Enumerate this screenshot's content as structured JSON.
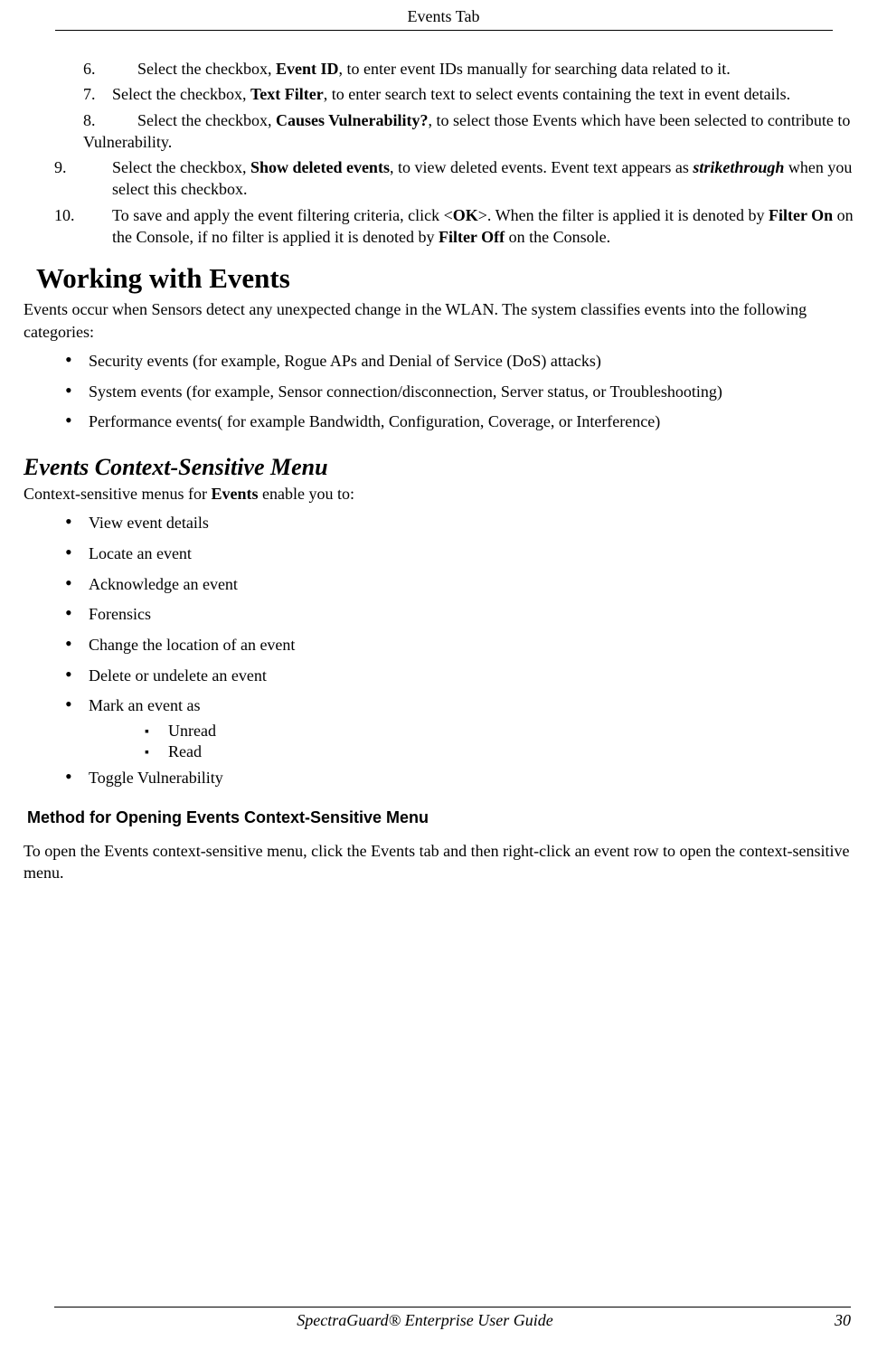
{
  "header": {
    "title": "Events Tab"
  },
  "ol": [
    {
      "num": "6.",
      "pre": "Select the checkbox, ",
      "bold": "Event ID",
      "post": ", to enter event IDs manually for searching data related to it.",
      "wide_num": true
    },
    {
      "num": "7.",
      "pre": "Select the checkbox, ",
      "bold": "Text Filter",
      "post": ", to enter search text to select events containing the text in event details.",
      "wide_num": false
    },
    {
      "num": "8.",
      "pre": "Select the checkbox, ",
      "bold": "Causes Vulnerability?",
      "post": ", to select those Events which have been selected to contribute to Vulnerability.",
      "wide_num": true
    },
    {
      "num": "9.",
      "pre": "Select the checkbox, ",
      "bold": "Show deleted events",
      "post_a": ", to view deleted events. Event text appears as ",
      "bold_italic": "strikethrough",
      "post_b": " when you select this checkbox.",
      "wide_num": false
    },
    {
      "num": "10.",
      "pre": "To save and apply the event filtering criteria, click <",
      "bold_a": "OK",
      "mid_a": ">. When the filter is applied it is denoted by ",
      "bold_b": "Filter On",
      "mid_b": " on the Console, if no filter is applied it is denoted by ",
      "bold_c": "Filter Off",
      "post": " on the Console.",
      "wide_num": false
    }
  ],
  "section1": {
    "title": "Working with Events",
    "intro": "Events occur when Sensors detect any unexpected change in the WLAN. The system classifies events into the following categories:",
    "bullets": [
      "Security events (for example, Rogue APs and Denial of Service (DoS) attacks)",
      "System events (for example, Sensor connection/disconnection, Server status, or Troubleshooting)",
      "Performance events( for example Bandwidth, Configuration, Coverage, or Interference)"
    ]
  },
  "section2": {
    "title": "Events Context-Sensitive Menu",
    "intro_pre": "Context-sensitive menus for ",
    "intro_bold": "Events",
    "intro_post": " enable you to:",
    "bullets": [
      "View event details",
      "Locate an event",
      "Acknowledge an event",
      "Forensics",
      "Change the location of an event",
      "Delete or undelete an event",
      "Mark an event as"
    ],
    "sub_bullets": [
      "Unread",
      "Read"
    ],
    "bullets_after": [
      "Toggle Vulnerability"
    ]
  },
  "section3": {
    "title": "Method for Opening Events Context-Sensitive Menu",
    "body": "To open the Events context-sensitive menu, click the Events tab and then right-click an event row to open the context-sensitive menu."
  },
  "footer": {
    "title": "SpectraGuard®  Enterprise User Guide",
    "page": "30"
  }
}
